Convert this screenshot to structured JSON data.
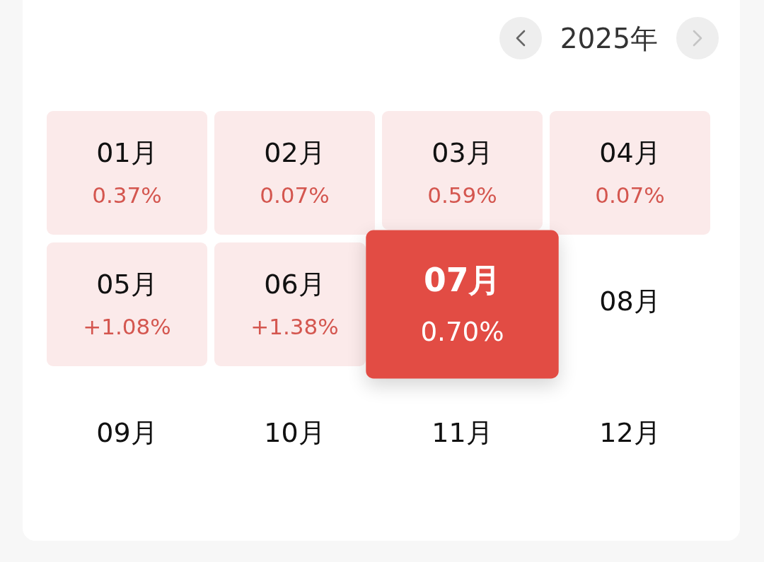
{
  "header": {
    "year": "2025年",
    "prev": {
      "disabled": false
    },
    "next": {
      "disabled": true
    }
  },
  "months": [
    {
      "label": "01月",
      "value": "0.37%",
      "selected": false
    },
    {
      "label": "02月",
      "value": "0.07%",
      "selected": false
    },
    {
      "label": "03月",
      "value": "0.59%",
      "selected": false
    },
    {
      "label": "04月",
      "value": "0.07%",
      "selected": false
    },
    {
      "label": "05月",
      "value": "+1.08%",
      "selected": false
    },
    {
      "label": "06月",
      "value": "+1.38%",
      "selected": false
    },
    {
      "label": "07月",
      "value": "0.70%",
      "selected": true
    },
    {
      "label": "08月",
      "selected": false
    },
    {
      "label": "09月",
      "selected": false
    },
    {
      "label": "10月",
      "selected": false
    },
    {
      "label": "11月",
      "selected": false
    },
    {
      "label": "12月",
      "selected": false
    }
  ]
}
